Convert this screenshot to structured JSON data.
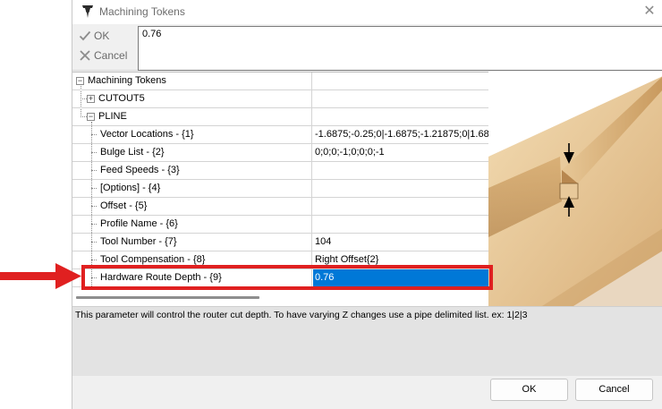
{
  "window": {
    "title": "Machining Tokens",
    "close_glyph": "✕"
  },
  "toolbar": {
    "ok_label": "OK",
    "cancel_label": "Cancel",
    "value": "0.76"
  },
  "tree": {
    "root": "Machining Tokens",
    "cutout": "CUTOUT5",
    "pline": "PLINE",
    "rows": [
      {
        "label": "Vector Locations - {1}",
        "value": "-1.6875;-0.25;0|-1.6875;-1.21875;0|1.68"
      },
      {
        "label": "Bulge List - {2}",
        "value": "0;0;0;-1;0;0;0;-1"
      },
      {
        "label": "Feed Speeds - {3}",
        "value": ""
      },
      {
        "label": "[Options] - {4}",
        "value": ""
      },
      {
        "label": "Offset - {5}",
        "value": ""
      },
      {
        "label": "Profile Name - {6}",
        "value": ""
      },
      {
        "label": "Tool Number - {7}",
        "value": "104"
      },
      {
        "label": "Tool Compensation - {8}",
        "value": "Right Offset{2}"
      },
      {
        "label": "Hardware Route Depth - {9}",
        "value": "0.76"
      }
    ]
  },
  "help_text": "This parameter will control the router cut depth. To have varying Z changes use a pipe delimited list. ex: 1|2|3",
  "buttons": {
    "ok": "OK",
    "cancel": "Cancel"
  },
  "colors": {
    "selection": "#0078d7",
    "annotation": "#e02020"
  }
}
